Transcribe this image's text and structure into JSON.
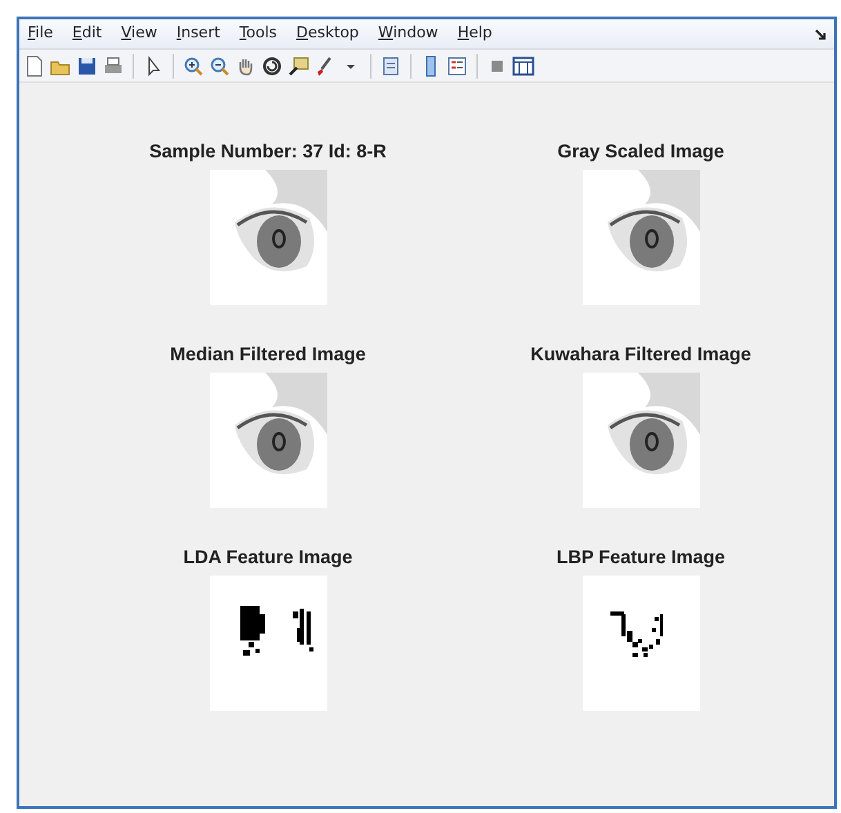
{
  "menu": [
    "File",
    "Edit",
    "View",
    "Insert",
    "Tools",
    "Desktop",
    "Window",
    "Help"
  ],
  "axes": [
    {
      "title": "Sample Number: 37 Id: 8-R",
      "kind": "eye"
    },
    {
      "title": "Gray Scaled Image",
      "kind": "eye"
    },
    {
      "title": "Median Filtered Image",
      "kind": "eye"
    },
    {
      "title": "Kuwahara Filtered Image",
      "kind": "eye"
    },
    {
      "title": "LDA Feature Image",
      "kind": "lda"
    },
    {
      "title": "LBP Feature Image",
      "kind": "lbp"
    }
  ]
}
